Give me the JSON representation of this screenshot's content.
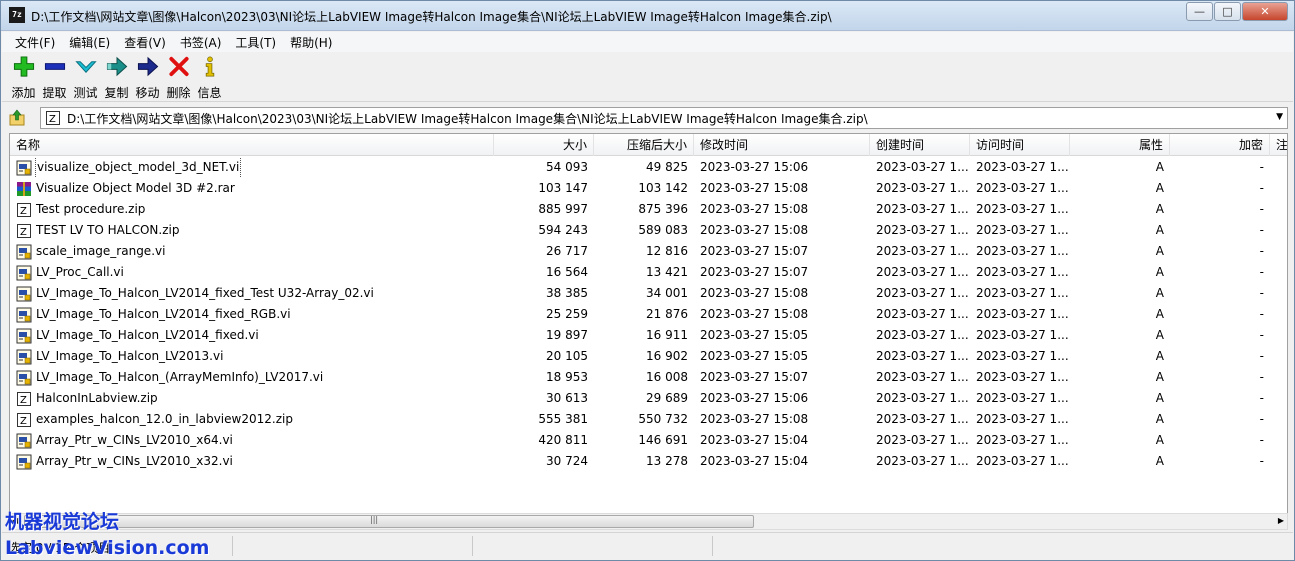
{
  "title_bar": {
    "app_icon": "7z",
    "title": "D:\\工作文档\\网站文章\\图像\\Halcon\\2023\\03\\NI论坛上LabVIEW Image转Halcon Image集合\\NI论坛上LabVIEW Image转Halcon Image集合.zip\\"
  },
  "menu": [
    "文件(F)",
    "编辑(E)",
    "查看(V)",
    "书签(A)",
    "工具(T)",
    "帮助(H)"
  ],
  "toolbar": [
    {
      "label": "添加",
      "icon": "add-icon",
      "color": "#1db11d"
    },
    {
      "label": "提取",
      "icon": "extract-icon",
      "color": "#1b2fb8"
    },
    {
      "label": "测试",
      "icon": "test-icon",
      "color": "#17b5c9"
    },
    {
      "label": "复制",
      "icon": "copy-icon",
      "color": "#1a8a8a"
    },
    {
      "label": "移动",
      "icon": "move-icon",
      "color": "#1b2a8c"
    },
    {
      "label": "删除",
      "icon": "delete-icon",
      "color": "#e01010"
    },
    {
      "label": "信息",
      "icon": "info-icon",
      "color": "#e0c000"
    }
  ],
  "address": {
    "path": "D:\\工作文档\\网站文章\\图像\\Halcon\\2023\\03\\NI论坛上LabVIEW Image转Halcon Image集合\\NI论坛上LabVIEW Image转Halcon Image集合.zip\\"
  },
  "columns": [
    "名称",
    "大小",
    "压缩后大小",
    "修改时间",
    "创建时间",
    "访问时间",
    "属性",
    "加密",
    "注"
  ],
  "files": [
    {
      "name": "visualize_object_model_3d_NET.vi",
      "type": "vi",
      "size": "54 093",
      "packed": "49 825",
      "modified": "2023-03-27 15:06",
      "created": "2023-03-27 1...",
      "accessed": "2023-03-27 1...",
      "attr": "A",
      "enc": "-"
    },
    {
      "name": "Visualize Object Model 3D #2.rar",
      "type": "rar",
      "size": "103 147",
      "packed": "103 142",
      "modified": "2023-03-27 15:08",
      "created": "2023-03-27 1...",
      "accessed": "2023-03-27 1...",
      "attr": "A",
      "enc": "-"
    },
    {
      "name": "Test procedure.zip",
      "type": "zip",
      "size": "885 997",
      "packed": "875 396",
      "modified": "2023-03-27 15:08",
      "created": "2023-03-27 1...",
      "accessed": "2023-03-27 1...",
      "attr": "A",
      "enc": "-"
    },
    {
      "name": "TEST LV TO HALCON.zip",
      "type": "zip",
      "size": "594 243",
      "packed": "589 083",
      "modified": "2023-03-27 15:08",
      "created": "2023-03-27 1...",
      "accessed": "2023-03-27 1...",
      "attr": "A",
      "enc": "-"
    },
    {
      "name": "scale_image_range.vi",
      "type": "vi",
      "size": "26 717",
      "packed": "12 816",
      "modified": "2023-03-27 15:07",
      "created": "2023-03-27 1...",
      "accessed": "2023-03-27 1...",
      "attr": "A",
      "enc": "-"
    },
    {
      "name": "LV_Proc_Call.vi",
      "type": "vi",
      "size": "16 564",
      "packed": "13 421",
      "modified": "2023-03-27 15:07",
      "created": "2023-03-27 1...",
      "accessed": "2023-03-27 1...",
      "attr": "A",
      "enc": "-"
    },
    {
      "name": "LV_Image_To_Halcon_LV2014_fixed_Test U32-Array_02.vi",
      "type": "vi",
      "size": "38 385",
      "packed": "34 001",
      "modified": "2023-03-27 15:08",
      "created": "2023-03-27 1...",
      "accessed": "2023-03-27 1...",
      "attr": "A",
      "enc": "-"
    },
    {
      "name": "LV_Image_To_Halcon_LV2014_fixed_RGB.vi",
      "type": "vi",
      "size": "25 259",
      "packed": "21 876",
      "modified": "2023-03-27 15:08",
      "created": "2023-03-27 1...",
      "accessed": "2023-03-27 1...",
      "attr": "A",
      "enc": "-"
    },
    {
      "name": "LV_Image_To_Halcon_LV2014_fixed.vi",
      "type": "vi",
      "size": "19 897",
      "packed": "16 911",
      "modified": "2023-03-27 15:05",
      "created": "2023-03-27 1...",
      "accessed": "2023-03-27 1...",
      "attr": "A",
      "enc": "-"
    },
    {
      "name": "LV_Image_To_Halcon_LV2013.vi",
      "type": "vi",
      "size": "20 105",
      "packed": "16 902",
      "modified": "2023-03-27 15:05",
      "created": "2023-03-27 1...",
      "accessed": "2023-03-27 1...",
      "attr": "A",
      "enc": "-"
    },
    {
      "name": "LV_Image_To_Halcon_(ArrayMemInfo)_LV2017.vi",
      "type": "vi",
      "size": "18 953",
      "packed": "16 008",
      "modified": "2023-03-27 15:07",
      "created": "2023-03-27 1...",
      "accessed": "2023-03-27 1...",
      "attr": "A",
      "enc": "-"
    },
    {
      "name": "HalconInLabview.zip",
      "type": "zip",
      "size": "30 613",
      "packed": "29 689",
      "modified": "2023-03-27 15:06",
      "created": "2023-03-27 1...",
      "accessed": "2023-03-27 1...",
      "attr": "A",
      "enc": "-"
    },
    {
      "name": "examples_halcon_12.0_in_labview2012.zip",
      "type": "zip",
      "size": "555 381",
      "packed": "550 732",
      "modified": "2023-03-27 15:08",
      "created": "2023-03-27 1...",
      "accessed": "2023-03-27 1...",
      "attr": "A",
      "enc": "-"
    },
    {
      "name": "Array_Ptr_w_CINs_LV2010_x64.vi",
      "type": "vi",
      "size": "420 811",
      "packed": "146 691",
      "modified": "2023-03-27 15:04",
      "created": "2023-03-27 1...",
      "accessed": "2023-03-27 1...",
      "attr": "A",
      "enc": "-"
    },
    {
      "name": "Array_Ptr_w_CINs_LV2010_x32.vi",
      "type": "vi",
      "size": "30 724",
      "packed": "13 278",
      "modified": "2023-03-27 15:04",
      "created": "2023-03-27 1...",
      "accessed": "2023-03-27 1...",
      "attr": "A",
      "enc": "-"
    }
  ],
  "status": {
    "text": "选定 0 / 15 个项目"
  },
  "watermark": {
    "line1": "机器视觉论坛",
    "line2": "LabviewVision.com"
  }
}
